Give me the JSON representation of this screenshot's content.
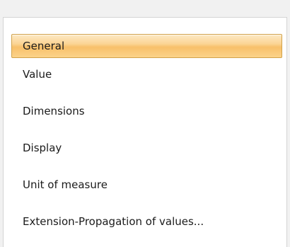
{
  "nav": {
    "selected_index": 0,
    "items": [
      {
        "label": "General"
      },
      {
        "label": "Value"
      },
      {
        "label": "Dimensions"
      },
      {
        "label": "Display"
      },
      {
        "label": "Unit of measure"
      },
      {
        "label": "Extension-Propagation of values..."
      }
    ]
  },
  "colors": {
    "selected_background": "#fbd595",
    "selected_border": "#d1a24a",
    "panel_background": "#ffffff",
    "panel_border": "#d4d4d4",
    "page_background": "#f1f1f1"
  }
}
